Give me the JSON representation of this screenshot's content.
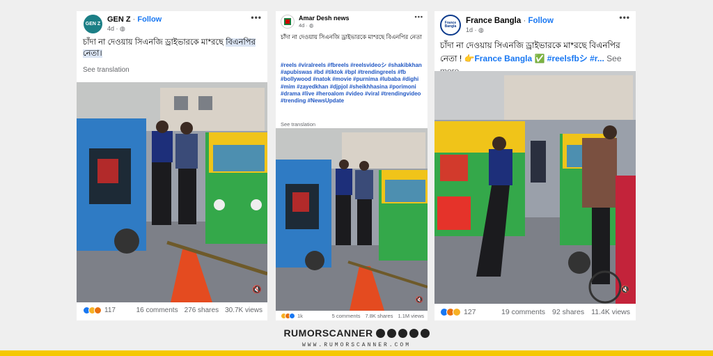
{
  "posts": [
    {
      "page_name": "GEN Z",
      "avatar_text": "GEN Z",
      "avatar_color": "#1c7f86",
      "follow_label": "Follow",
      "time": "4d",
      "caption_part1": "চাঁদা না দেওয়ায় সিএনজি ড্রাইভারকে মা*রছে ",
      "caption_highlight": "বিএনপির নেতা।",
      "see_translation": "See translation",
      "reaction_count": "117",
      "comments": "16 comments",
      "shares": "276 shares",
      "views": "30.7K views",
      "menu_icon": "more-horizontal-icon"
    },
    {
      "page_name": "Amar Desh news",
      "avatar_text": "",
      "avatar_color": "#cc0000",
      "time": "4d",
      "caption": "চাঁদা না দেওয়ায় সিএনজি ড্রাইভারকে মা*রছে বিএনপির নেতা",
      "hashtags": "#reels #viralreels #fbreels #reelsvideoシ #shakibkhan #apubiswas #bd #tiktok #bpl #trendingreels #fb #bollywood #natok #movie #purnima #lubaba #dighi #mim #zayedkhan #djpjol #sheikhhasina #porimoni #drama #live #heroalom #video #viral #trendingvideo #trending #NewsUpdate",
      "see_translation": "See translation",
      "reaction_count": "1k",
      "comments": "5 comments",
      "shares": "7.8K shares",
      "views": "1.1M views",
      "menu_icon": "more-horizontal-icon"
    },
    {
      "page_name": "France Bangla",
      "avatar_text": "France Bangla",
      "avatar_color": "#0d3b8c",
      "follow_label": "Follow",
      "time": "1d",
      "caption": "চাঁদা না দেওয়ায় সিএনজি ড্রাইভারকে মা*রছে বিএনপির নেতা ! ",
      "caption_links": "👉France Bangla ✅ #reelsfbシ #r...",
      "see_more": "See more",
      "reaction_count": "127",
      "comments": "19 comments",
      "shares": "92 shares",
      "views": "11.4K views",
      "menu_icon": "more-horizontal-icon"
    }
  ],
  "brand": {
    "name": "RUMORSCANNER",
    "url": "WWW.RUMORSCANNER.COM",
    "accent_color": "#f5c800",
    "social_icons": [
      "facebook-icon",
      "youtube-icon",
      "twitter-icon",
      "instagram-icon",
      "tiktok-icon"
    ]
  },
  "colors": {
    "link_blue": "#1877f2",
    "hashtag_blue": "#1f56c3",
    "muted": "#65676b"
  }
}
